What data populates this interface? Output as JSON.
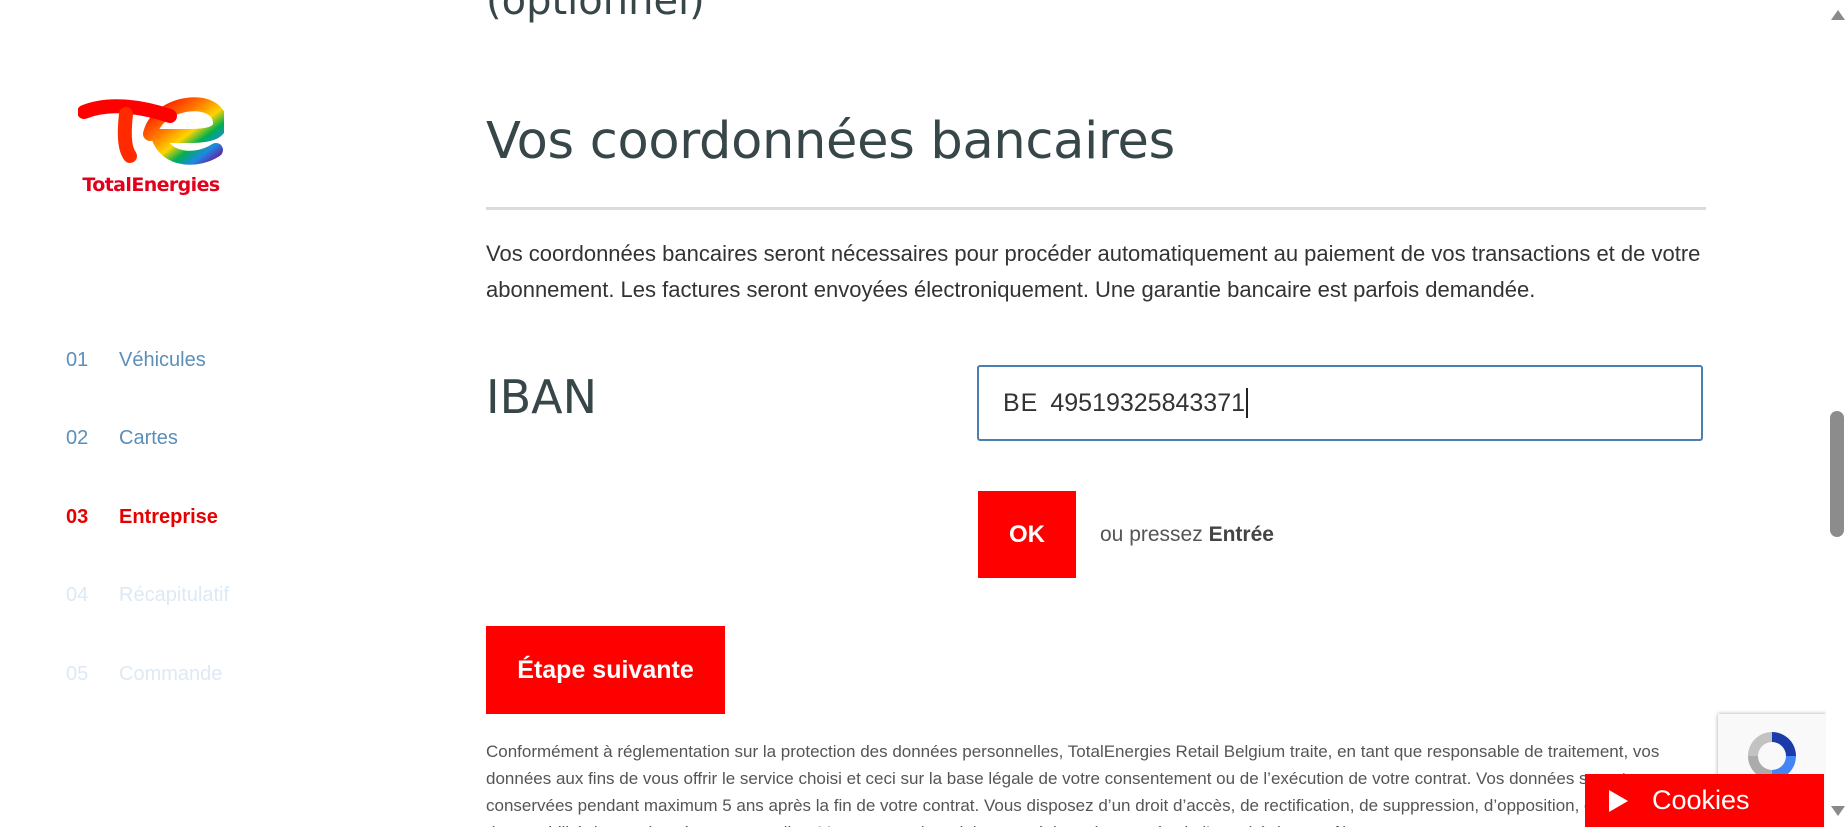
{
  "brand": {
    "name": "TotalEnergies",
    "color": "#e2001a"
  },
  "sidebar": {
    "steps": [
      {
        "num": "01",
        "label": "Véhicules",
        "state": "done"
      },
      {
        "num": "02",
        "label": "Cartes",
        "state": "done"
      },
      {
        "num": "03",
        "label": "Entreprise",
        "state": "active"
      },
      {
        "num": "04",
        "label": "Récapitulatif",
        "state": "todo"
      },
      {
        "num": "05",
        "label": "Commande",
        "state": "todo"
      }
    ]
  },
  "main": {
    "top_cut_text": "(optionnel)",
    "section_title": "Vos coordonnées bancaires",
    "intro": "Vos coordonnées bancaires seront nécessaires pour procéder automatiquement au paiement de vos transactions et de votre abonnement. Les factures seront envoyées électroniquement. Une garantie bancaire est parfois demandée.",
    "iban": {
      "label": "IBAN",
      "country": "BE",
      "value": "49519325843371"
    },
    "ok_button": "OK",
    "ok_hint_prefix": "ou pressez",
    "ok_hint_key": "Entrée",
    "next_button": "Étape suivante",
    "legal": "Conformément à réglementation sur la protection des données personnelles, TotalEnergies Retail Belgium traite, en tant que responsable de traitement, vos données aux fins de vous offrir le service choisi et ceci sur la base légale de votre consentement ou de l’exécution de votre contrat. Vos données seront conservées pendant maximum 5 ans après la fin de votre contrat. Vous disposez d’un droit d’accès, de rectification, de suppression, d’opposition, de limitation et de portabilité de vos données personnelles. Vous pouvez introduire une réclamation auprès de l’autorité de contrôle."
  },
  "cookies": {
    "label": "Cookies"
  },
  "colors": {
    "accent": "#ff0000",
    "step_done": "#5b8fb9",
    "step_todo": "#dde9f4",
    "title": "#374649",
    "input_border": "#4a7fb0"
  }
}
